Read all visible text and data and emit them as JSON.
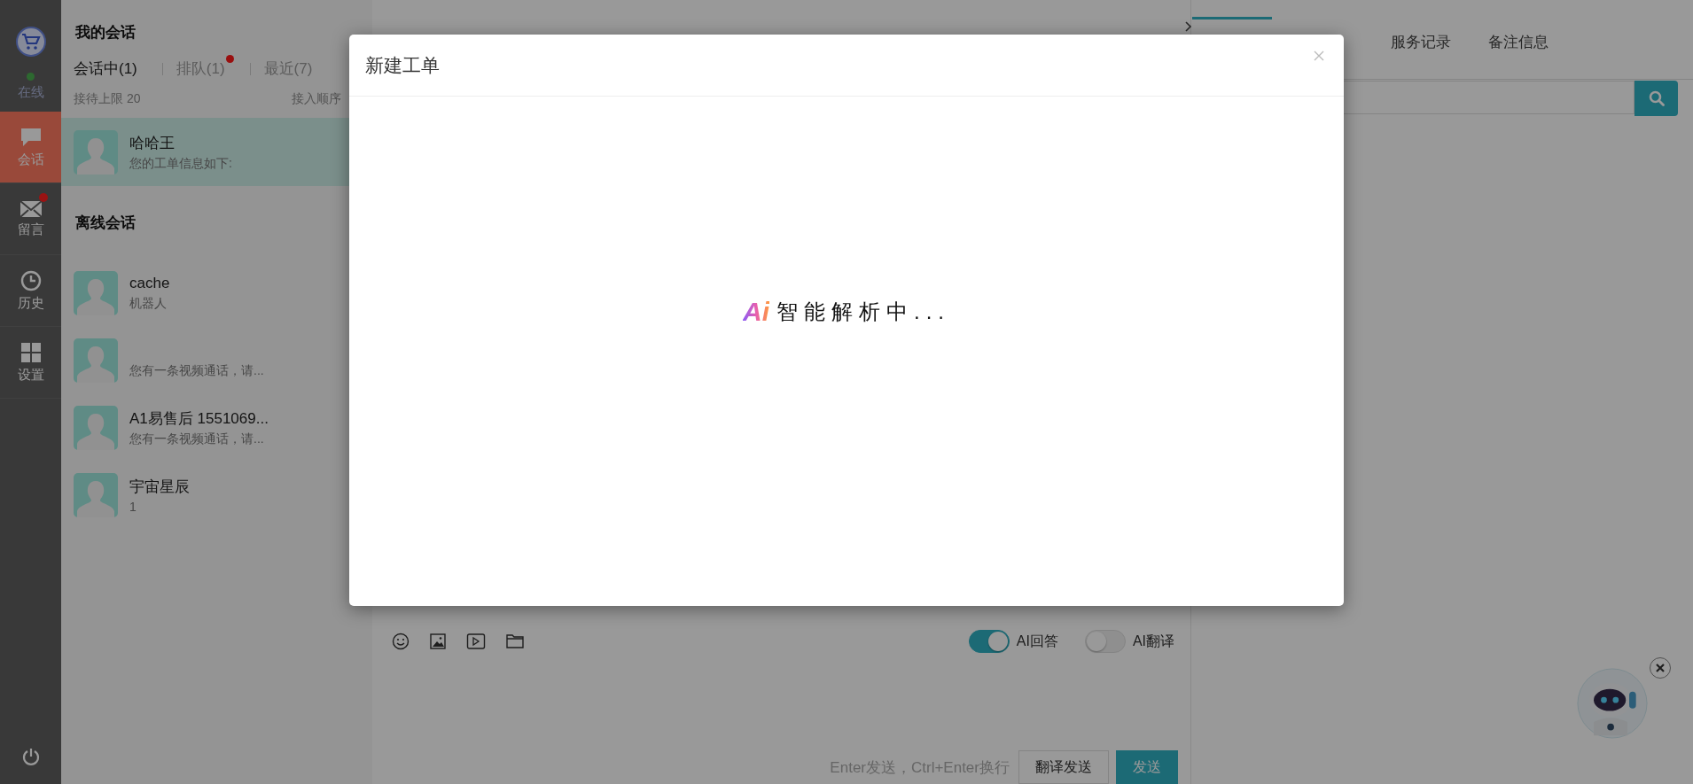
{
  "sidebar": {
    "status": {
      "label": "在线",
      "online": true
    },
    "items": [
      {
        "label": "会话",
        "kind": "chat",
        "selected": true,
        "badge": false
      },
      {
        "label": "留言",
        "kind": "mail",
        "selected": false,
        "badge": true
      },
      {
        "label": "历史",
        "kind": "history",
        "selected": false,
        "badge": false
      },
      {
        "label": "设置",
        "kind": "settings",
        "selected": false,
        "badge": false
      }
    ]
  },
  "conversations": {
    "title": "我的会话",
    "tabs": [
      {
        "label": "会话中(1)",
        "selected": true,
        "badge": false
      },
      {
        "label": "排队(1)",
        "selected": false,
        "badge": true
      },
      {
        "label": "最近(7)",
        "selected": false,
        "badge": false
      }
    ],
    "limit": "接待上限 20",
    "order": "接入顺序",
    "active": [
      {
        "name": "哈哈王",
        "preview": "您的工单信息如下:",
        "selected": true
      }
    ],
    "offline_title": "离线会话",
    "offline": [
      {
        "name": "cache",
        "preview": "机器人",
        "selected": false
      },
      {
        "preview": "您有一条视频通话，请...",
        "selected": false
      },
      {
        "name": "A1易售后 1551069...",
        "preview": "您有一条视频通话，请...",
        "selected": false
      },
      {
        "name": "宇宙星辰",
        "preview": "1",
        "selected": false
      }
    ]
  },
  "chat": {
    "toggles": [
      {
        "label": "AI回答",
        "on": true
      },
      {
        "label": "AI翻译",
        "on": false
      }
    ],
    "hint": "Enter发送，Ctrl+Enter换行",
    "buttons": [
      {
        "label": "翻译发送",
        "kind": "default"
      },
      {
        "label": "发送",
        "kind": "primary"
      }
    ]
  },
  "right_panel": {
    "tabs": [
      {
        "label": "服务记录",
        "selected": false
      },
      {
        "label": "备注信息",
        "selected": false
      }
    ]
  },
  "modal": {
    "title": "新建工单",
    "ai_mark": "Ai",
    "loading": "智能解析中..."
  }
}
